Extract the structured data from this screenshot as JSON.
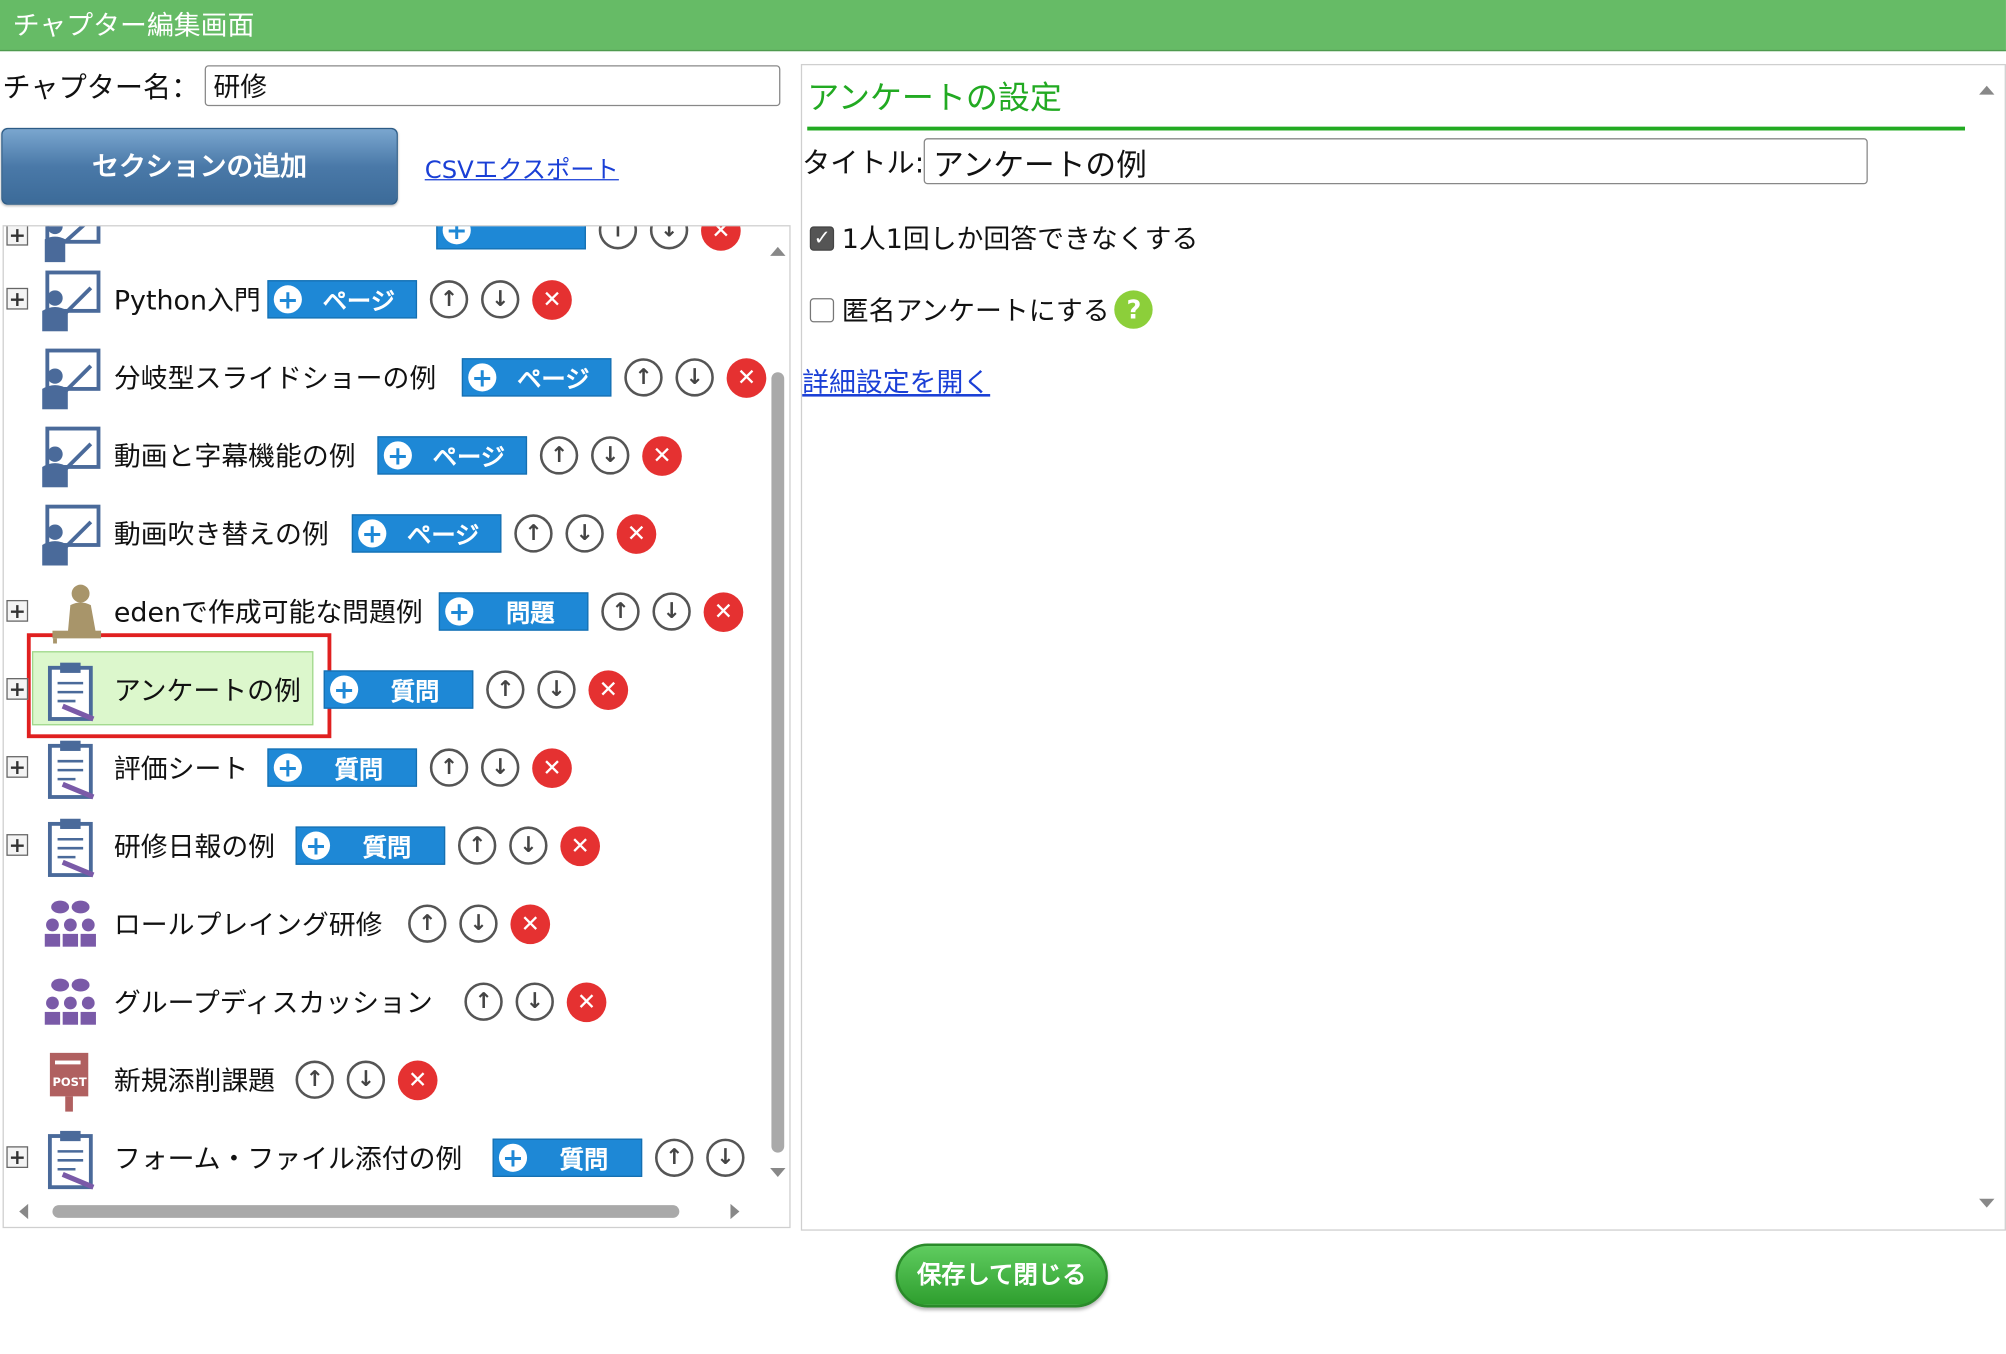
{
  "header": {
    "title": "チャプター編集画面"
  },
  "chapter": {
    "label": "チャプター名：",
    "value": "研修"
  },
  "toolbar": {
    "add_section_label": "セクションの追加",
    "csv_export_label": "CSVエクスポート"
  },
  "tree": {
    "items": [
      {
        "label": "Python入門",
        "icon": "lecture-icon",
        "expander": "⊞",
        "add_label": "ページ"
      },
      {
        "label": "分岐型スライドショーの例",
        "icon": "lecture-icon",
        "expander": "",
        "add_label": "ページ"
      },
      {
        "label": "動画と字幕機能の例",
        "icon": "lecture-icon",
        "expander": "",
        "add_label": "ページ"
      },
      {
        "label": "動画吹き替えの例",
        "icon": "lecture-icon",
        "expander": "",
        "add_label": "ページ"
      },
      {
        "label": "edenで作成可能な問題例",
        "icon": "exam-icon",
        "expander": "⊞",
        "add_label": "問題"
      },
      {
        "label": "アンケートの例",
        "icon": "survey-icon",
        "expander": "⊞",
        "add_label": "質問"
      },
      {
        "label": "評価シート",
        "icon": "survey-icon",
        "expander": "⊞",
        "add_label": "質問"
      },
      {
        "label": "研修日報の例",
        "icon": "survey-icon",
        "expander": "⊞",
        "add_label": "質問"
      },
      {
        "label": "ロールプレイング研修",
        "icon": "group-icon",
        "expander": "",
        "add_label": ""
      },
      {
        "label": "グループディスカッション",
        "icon": "group-icon",
        "expander": "",
        "add_label": ""
      },
      {
        "label": "新規添削課題",
        "icon": "post-icon",
        "expander": "",
        "add_label": ""
      },
      {
        "label": "フォーム・ファイル添付の例",
        "icon": "survey-icon",
        "expander": "⊞",
        "add_label": "質問"
      }
    ]
  },
  "settings": {
    "heading": "アンケートの設定",
    "title_label": "タイトル:",
    "title_value": "アンケートの例",
    "single_answer_label": "1人1回しか回答できなくする",
    "single_answer_checked": true,
    "anonymous_label": "匿名アンケートにする",
    "anonymous_checked": false,
    "detail_link": "詳細設定を開く"
  },
  "footer": {
    "save_label": "保存して閉じる"
  },
  "colors": {
    "header": "#66bb66",
    "accent_green": "#22aa22",
    "add_button": "#1e88d6",
    "delete": "#e53131",
    "selected": "#dcf7cc"
  }
}
